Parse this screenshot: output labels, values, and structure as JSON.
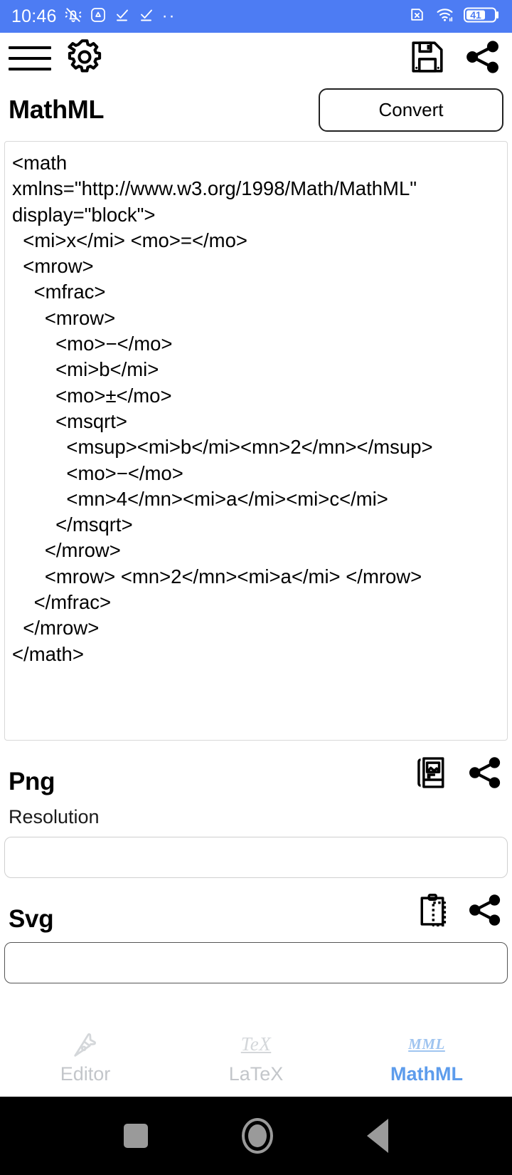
{
  "statusbar": {
    "time": "10:46",
    "battery": "41",
    "left_icons": [
      "bell-muted-icon",
      "triangle-drive-icon",
      "task-check-icon",
      "task-check-icon"
    ],
    "overflow": "··",
    "right_icons": [
      "sim-missing-icon",
      "wifi-icon",
      "battery-icon"
    ],
    "background": "#4d7cf3"
  },
  "toolbar": {
    "menu_icon": "hamburger-menu-icon",
    "settings_icon": "gear-icon",
    "save_icon": "floppy-save-icon",
    "share_icon": "share-icon"
  },
  "header": {
    "title": "MathML",
    "convert_label": "Convert"
  },
  "editor": {
    "content": "<math\nxmlns=\"http://www.w3.org/1998/Math/MathML\"\ndisplay=\"block\">\n  <mi>x</mi> <mo>=</mo>\n  <mrow>\n    <mfrac>\n      <mrow>\n        <mo>−</mo>\n        <mi>b</mi>\n        <mo>±</mo>\n        <msqrt>\n          <msup><mi>b</mi><mn>2</mn></msup>\n          <mo>−</mo>\n          <mn>4</mn><mi>a</mi><mi>c</mi>\n        </msqrt>\n      </mrow>\n      <mrow> <mn>2</mn><mi>a</mi> </mrow>\n    </mfrac>\n  </mrow>\n</math>"
  },
  "png_section": {
    "title": "Png",
    "copy_icon": "copy-image-icon",
    "share_icon": "share-icon",
    "resolution_label": "Resolution",
    "resolution_value": "",
    "resolution_placeholder": ""
  },
  "svg_section": {
    "title": "Svg",
    "copy_icon": "clipboard-copy-icon",
    "share_icon": "share-icon",
    "value": "",
    "placeholder": ""
  },
  "tabs": [
    {
      "label": "Editor",
      "glyph": "pen-nib-icon",
      "active": false
    },
    {
      "label": "LaTeX",
      "glyph": "TeX",
      "active": false
    },
    {
      "label": "MathML",
      "glyph": "MML",
      "active": true
    }
  ],
  "navbar": {
    "recents": "square-recents-icon",
    "home": "circle-home-icon",
    "back": "triangle-back-icon"
  },
  "colors": {
    "accent": "#4d7cf3",
    "tab_active": "#5d9cec",
    "tab_inactive": "#c3c6ca"
  }
}
